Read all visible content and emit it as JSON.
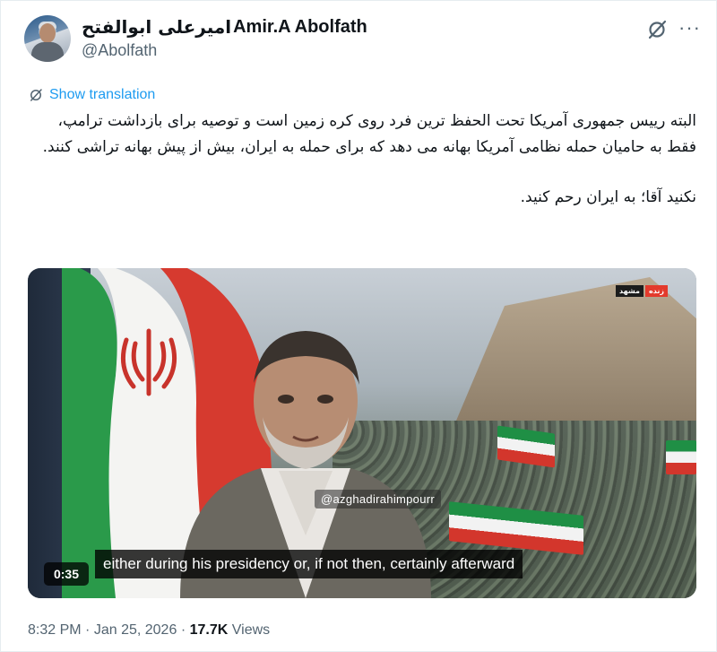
{
  "author": {
    "name_persian": "امیرعلی ابوالفتح",
    "name_latin": "Amir.A Abolfath",
    "handle": "@Abolfath"
  },
  "translate_label": "Show translation",
  "tweet": {
    "paragraph1": "البته رییس جمهوری آمریکا تحت الحفظ ترین فرد روی کره زمین است و توصیه برای بازداشت ترامپ، فقط به حامیان حمله نظامی آمریکا بهانه می دهد که برای حمله به ایران، بیش از پیش بهانه تراشی کنند.",
    "paragraph2": "نکنید آقا؛ به ایران رحم کنید."
  },
  "video": {
    "duration": "0:35",
    "subtitle": "either during his presidency or, if not then, certainly afterward",
    "watermark": "@azghadirahimpourr",
    "logo_left": "زنده",
    "logo_right": "مشهد"
  },
  "meta": {
    "time": "8:32 PM",
    "date": "Jan 25, 2026",
    "views_count": "17.7K",
    "views_label": "Views"
  },
  "icons": {
    "grok": "grok-icon",
    "more": "more-icon",
    "translate": "translate-icon"
  },
  "colors": {
    "accent": "#1d9bf0",
    "muted_text": "#536471",
    "text": "#0f1419"
  }
}
